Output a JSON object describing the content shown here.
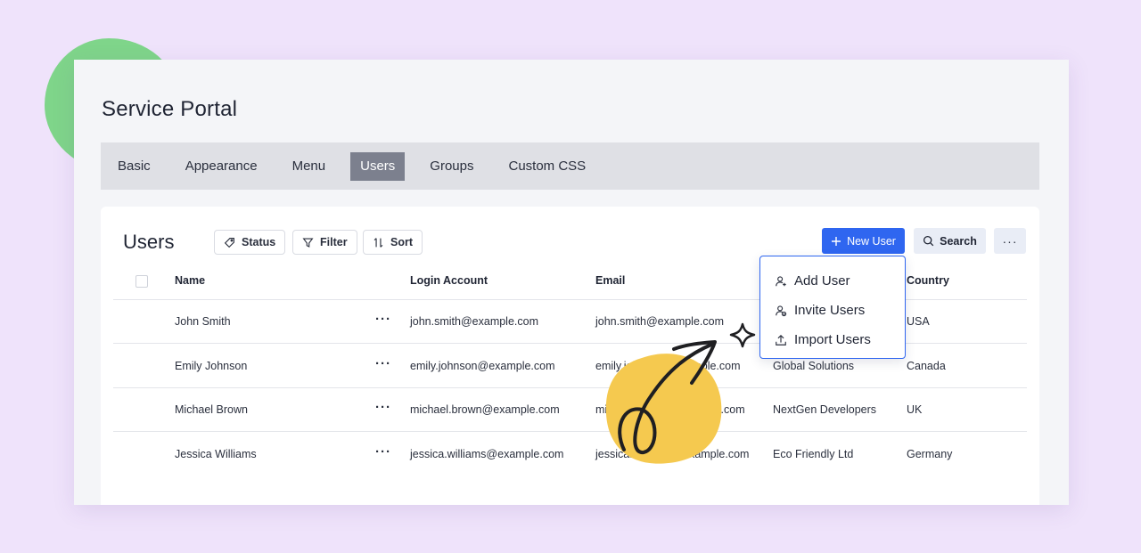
{
  "app": {
    "title": "Service Portal"
  },
  "tabs": [
    {
      "label": "Basic"
    },
    {
      "label": "Appearance"
    },
    {
      "label": "Menu"
    },
    {
      "label": "Users",
      "active": true
    },
    {
      "label": "Groups"
    },
    {
      "label": "Custom CSS"
    }
  ],
  "users_panel": {
    "heading": "Users",
    "chips": {
      "status": "Status",
      "filter": "Filter",
      "sort": "Sort"
    },
    "new_user_label": "New User",
    "search_label": "Search",
    "more_label": "···"
  },
  "table": {
    "columns": {
      "name": "Name",
      "login": "Login Account",
      "email": "Email",
      "country": "Country"
    },
    "row_menu": "···",
    "rows": [
      {
        "name": "John Smith",
        "login": "john.smith@example.com",
        "email": "john.smith@example.com",
        "company": "",
        "country": "USA"
      },
      {
        "name": "Emily Johnson",
        "login": "emily.johnson@example.com",
        "email": "emily.johnson@example.com",
        "company": "Global Solutions",
        "country": "Canada"
      },
      {
        "name": "Michael Brown",
        "login": "michael.brown@example.com",
        "email": "michael.brown@example.com",
        "company": "NextGen Developers",
        "country": "UK"
      },
      {
        "name": "Jessica Williams",
        "login": "jessica.williams@example.com",
        "email": "jessica.williams@example.com",
        "company": "Eco Friendly Ltd",
        "country": "Germany"
      }
    ]
  },
  "dropdown": {
    "items": [
      {
        "label": "Add User",
        "icon": "user-plus-icon"
      },
      {
        "label": "Invite Users",
        "icon": "user-invite-icon"
      },
      {
        "label": "Import Users",
        "icon": "upload-icon"
      }
    ]
  },
  "colors": {
    "background": "#efe3fb",
    "accent": "#2f66f0",
    "active_tab": "#7c808e",
    "blob_green": "#7fd58a",
    "blob_yellow": "#f5c94f"
  }
}
